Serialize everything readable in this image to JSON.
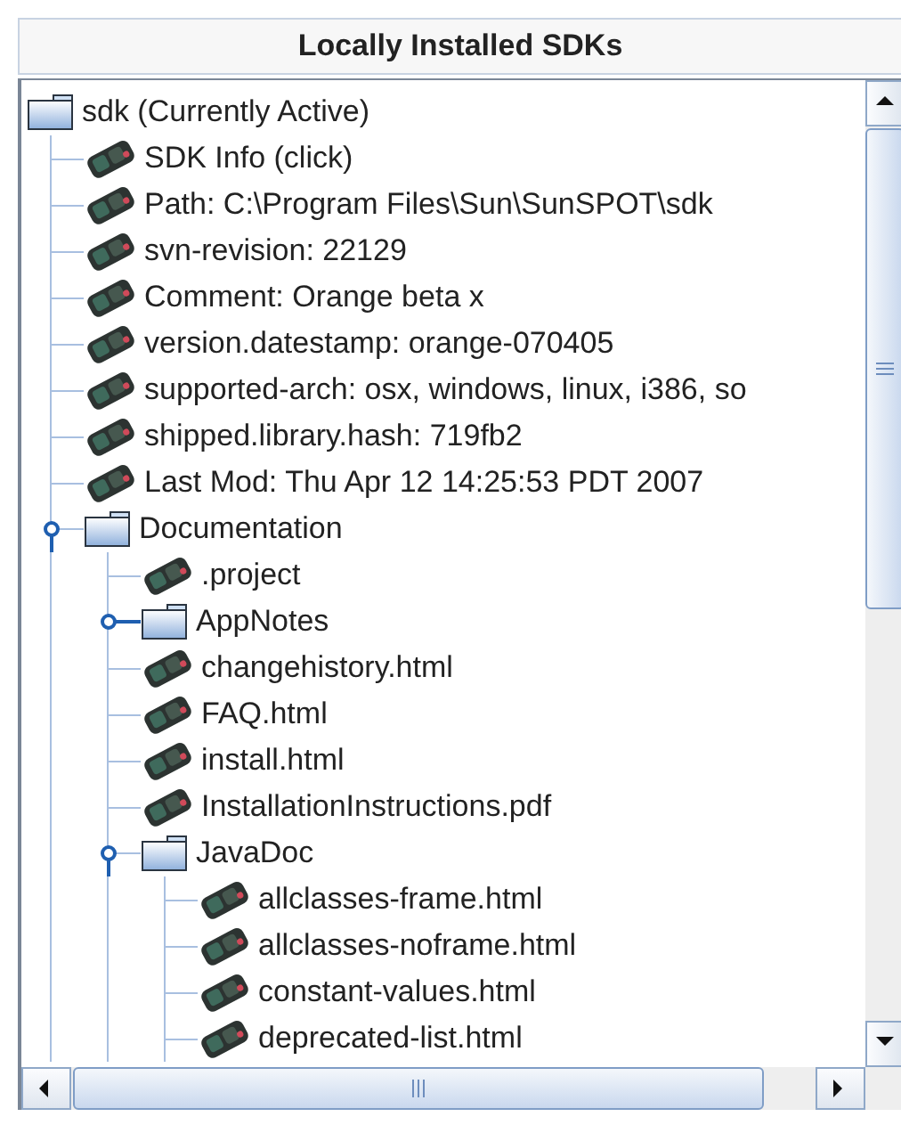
{
  "panel": {
    "title": "Locally Installed SDKs"
  },
  "tree": {
    "label": "sdk (Currently Active)",
    "kind": "folder",
    "children": [
      {
        "label": "SDK Info (click)",
        "kind": "leaf"
      },
      {
        "label": "Path: C:\\Program Files\\Sun\\SunSPOT\\sdk",
        "kind": "leaf"
      },
      {
        "label": "svn-revision: 22129",
        "kind": "leaf"
      },
      {
        "label": "Comment: Orange beta x",
        "kind": "leaf"
      },
      {
        "label": "version.datestamp: orange-070405",
        "kind": "leaf"
      },
      {
        "label": "supported-arch: osx, windows, linux, i386, so",
        "kind": "leaf"
      },
      {
        "label": "shipped.library.hash: 719fb2",
        "kind": "leaf"
      },
      {
        "label": "Last Mod: Thu Apr 12 14:25:53 PDT 2007",
        "kind": "leaf"
      },
      {
        "label": "Documentation",
        "kind": "folder",
        "expanded": true,
        "children": [
          {
            "label": ".project",
            "kind": "leaf"
          },
          {
            "label": "AppNotes",
            "kind": "folder",
            "expanded": false
          },
          {
            "label": "changehistory.html",
            "kind": "leaf"
          },
          {
            "label": "FAQ.html",
            "kind": "leaf"
          },
          {
            "label": "install.html",
            "kind": "leaf"
          },
          {
            "label": "InstallationInstructions.pdf",
            "kind": "leaf"
          },
          {
            "label": "JavaDoc",
            "kind": "folder",
            "expanded": true,
            "children": [
              {
                "label": "allclasses-frame.html",
                "kind": "leaf"
              },
              {
                "label": "allclasses-noframe.html",
                "kind": "leaf"
              },
              {
                "label": "constant-values.html",
                "kind": "leaf"
              },
              {
                "label": "deprecated-list.html",
                "kind": "leaf"
              }
            ]
          }
        ]
      }
    ]
  }
}
